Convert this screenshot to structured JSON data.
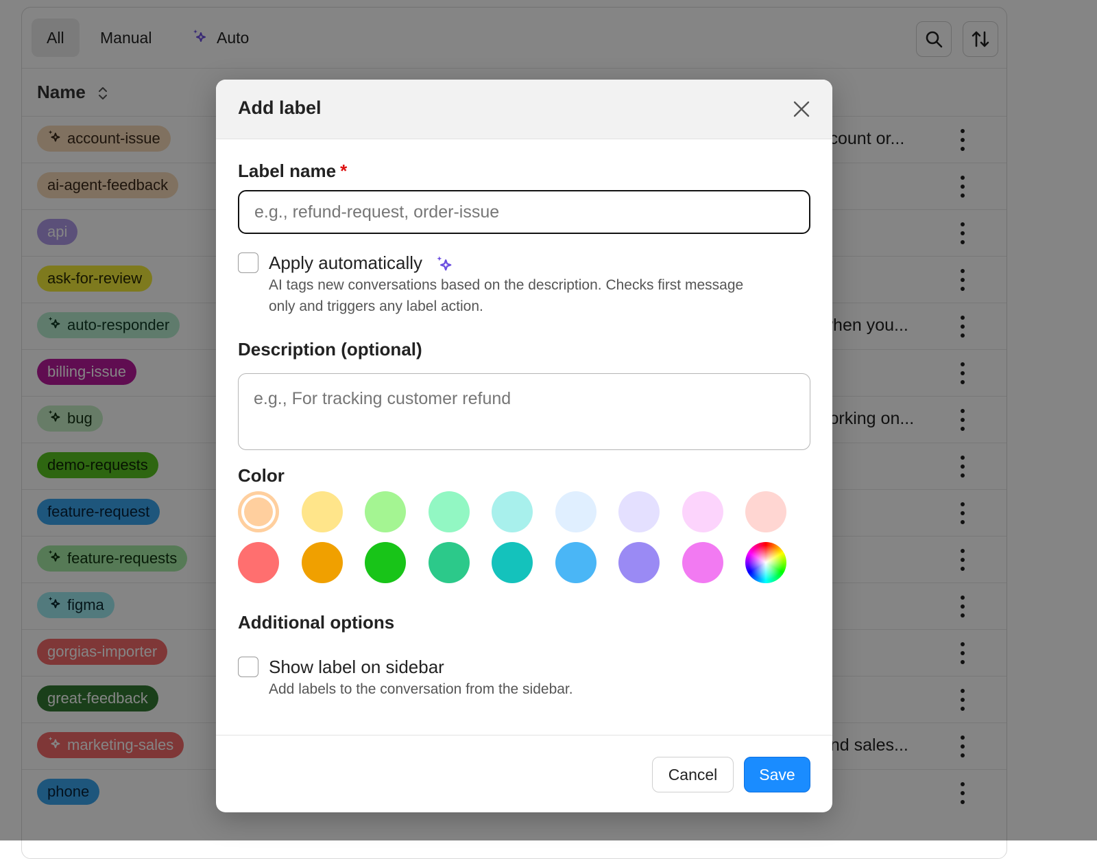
{
  "toolbar": {
    "tabs": [
      {
        "label": "All",
        "active": true
      },
      {
        "label": "Manual",
        "active": false
      },
      {
        "label": "Auto",
        "active": false,
        "icon": "sparkle-icon"
      }
    ],
    "icons": [
      "search-icon",
      "sort-icon"
    ]
  },
  "table": {
    "name_header": "Name",
    "rows": [
      {
        "name": "account-issue",
        "auto": true,
        "bg": "#f6d8b8",
        "fg": "#3a2a1a",
        "desc": "ccount or..."
      },
      {
        "name": "ai-agent-feedback",
        "auto": false,
        "bg": "#f6d8b8",
        "fg": "#3a2a1a",
        "desc": ""
      },
      {
        "name": "api",
        "auto": false,
        "bg": "#ae9ae8",
        "fg": "#ffffff",
        "desc": ""
      },
      {
        "name": "ask-for-review",
        "auto": false,
        "bg": "#f2ea3a",
        "fg": "#2a2a00",
        "desc": ""
      },
      {
        "name": "auto-responder",
        "auto": true,
        "bg": "#b6ecd0",
        "fg": "#103a25",
        "desc": "when you..."
      },
      {
        "name": "billing-issue",
        "auto": false,
        "bg": "#b81a9c",
        "fg": "#ffffff",
        "desc": ""
      },
      {
        "name": "bug",
        "auto": true,
        "bg": "#c6eec6",
        "fg": "#143214",
        "desc": "vorking on..."
      },
      {
        "name": "demo-requests",
        "auto": false,
        "bg": "#58c422",
        "fg": "#0e2605",
        "desc": ""
      },
      {
        "name": "feature-request",
        "auto": false,
        "bg": "#3aa6ee",
        "fg": "#06223a",
        "desc": ""
      },
      {
        "name": "feature-requests",
        "auto": true,
        "bg": "#a6eaa6",
        "fg": "#0e320e",
        "desc": ""
      },
      {
        "name": "figma",
        "auto": true,
        "bg": "#9eeaf0",
        "fg": "#0a2a30",
        "desc": ""
      },
      {
        "name": "gorgias-importer",
        "auto": false,
        "bg": "#f46a6a",
        "fg": "#ffffff",
        "desc": ""
      },
      {
        "name": "great-feedback",
        "auto": false,
        "bg": "#327a32",
        "fg": "#ffffff",
        "desc": ""
      },
      {
        "name": "marketing-sales",
        "auto": true,
        "bg": "#f46a6a",
        "fg": "#ffffff",
        "desc": "and sales..."
      },
      {
        "name": "phone",
        "auto": false,
        "bg": "#3aa6ee",
        "fg": "#06223a",
        "desc": ""
      }
    ]
  },
  "modal": {
    "title": "Add label",
    "label_name": {
      "label": "Label name",
      "required_mark": "*",
      "placeholder": "e.g., refund-request, order-issue",
      "value": ""
    },
    "apply_auto": {
      "label": "Apply automatically",
      "help": "AI tags new conversations based on the description. Checks first message only and triggers any label action.",
      "checked": false
    },
    "description": {
      "label": "Description (optional)",
      "placeholder": "e.g., For tracking customer refund",
      "value": ""
    },
    "color": {
      "label": "Color",
      "swatches": [
        "#ffcf9e",
        "#ffe58a",
        "#a4f592",
        "#92f7c3",
        "#a8f0ec",
        "#e0efff",
        "#e4e0ff",
        "#fcd4fc",
        "#ffd6d2",
        "#ff6f6f",
        "#f0a000",
        "#18c418",
        "#2cc98a",
        "#14c2bc",
        "#4ab6f6",
        "#9a8af4",
        "#f27af2",
        "custom"
      ],
      "selected_index": 0
    },
    "additional_options": {
      "label": "Additional options"
    },
    "show_sidebar": {
      "label": "Show label on sidebar",
      "help": "Add labels to the conversation from the sidebar.",
      "checked": false
    },
    "cancel_label": "Cancel",
    "save_label": "Save"
  }
}
